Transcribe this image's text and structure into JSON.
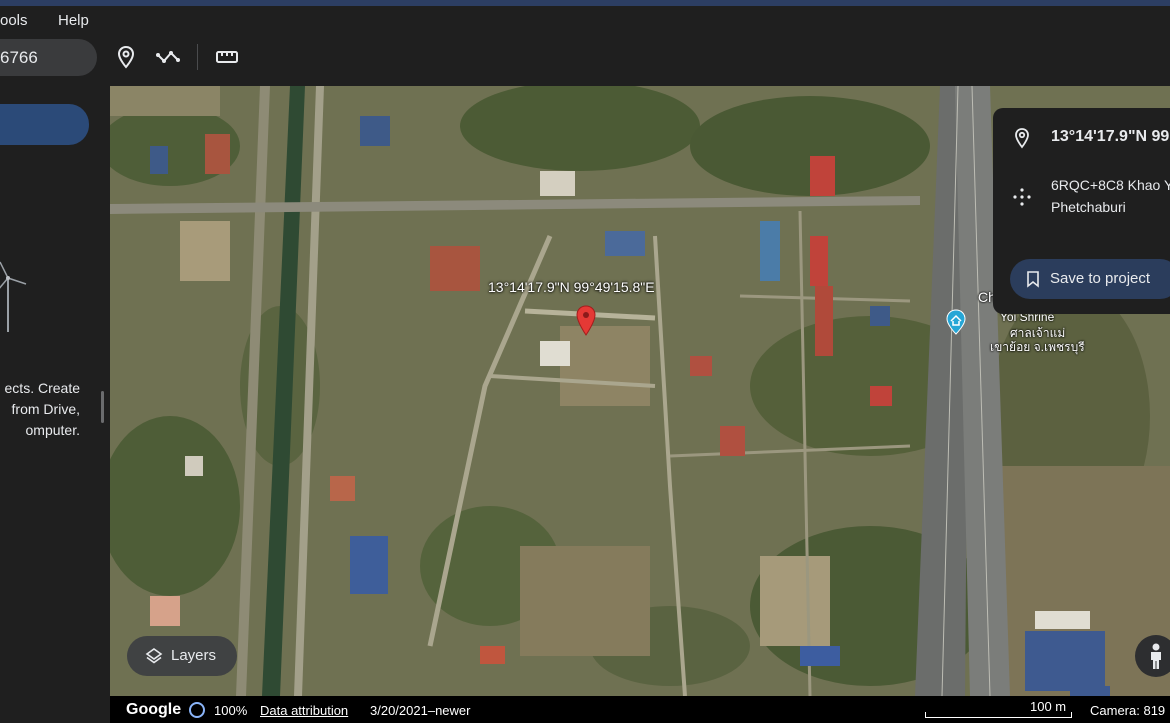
{
  "menu": {
    "tools": "ools",
    "help": "Help"
  },
  "search": {
    "value": "6766"
  },
  "toolbar": {
    "icons": [
      "location-pin-icon",
      "path-icon",
      "ruler-icon"
    ]
  },
  "sidebar": {
    "message_lines": [
      "ects. Create",
      "from Drive,",
      "omputer."
    ]
  },
  "map": {
    "marker_coord": "13°14'17.9\"N 99°49'15.8\"E",
    "place_ch": "Ch",
    "place_en": "Yoi Shrine",
    "place_th1": "ศาลเจ้าแม่",
    "place_th2": "เขาย้อย จ.เพชรบุรี"
  },
  "info_panel": {
    "coord": "13°14'17.9\"N 99°",
    "plus_code_line1": "6RQC+8C8 Khao Y",
    "plus_code_line2": "Phetchaburi",
    "save_label": "Save to project"
  },
  "layers": {
    "label": "Layers"
  },
  "status": {
    "logo": "Google",
    "zoom": "100%",
    "attribution": "Data attribution",
    "imagery_date": "3/20/2021–newer",
    "scale": "100 m",
    "camera": "Camera: 819"
  },
  "colors": {
    "accent_button": "#2b4a78",
    "save_button": "#2b3d5c",
    "marker": "#e53935",
    "shrine_pin": "#26a6d6"
  }
}
